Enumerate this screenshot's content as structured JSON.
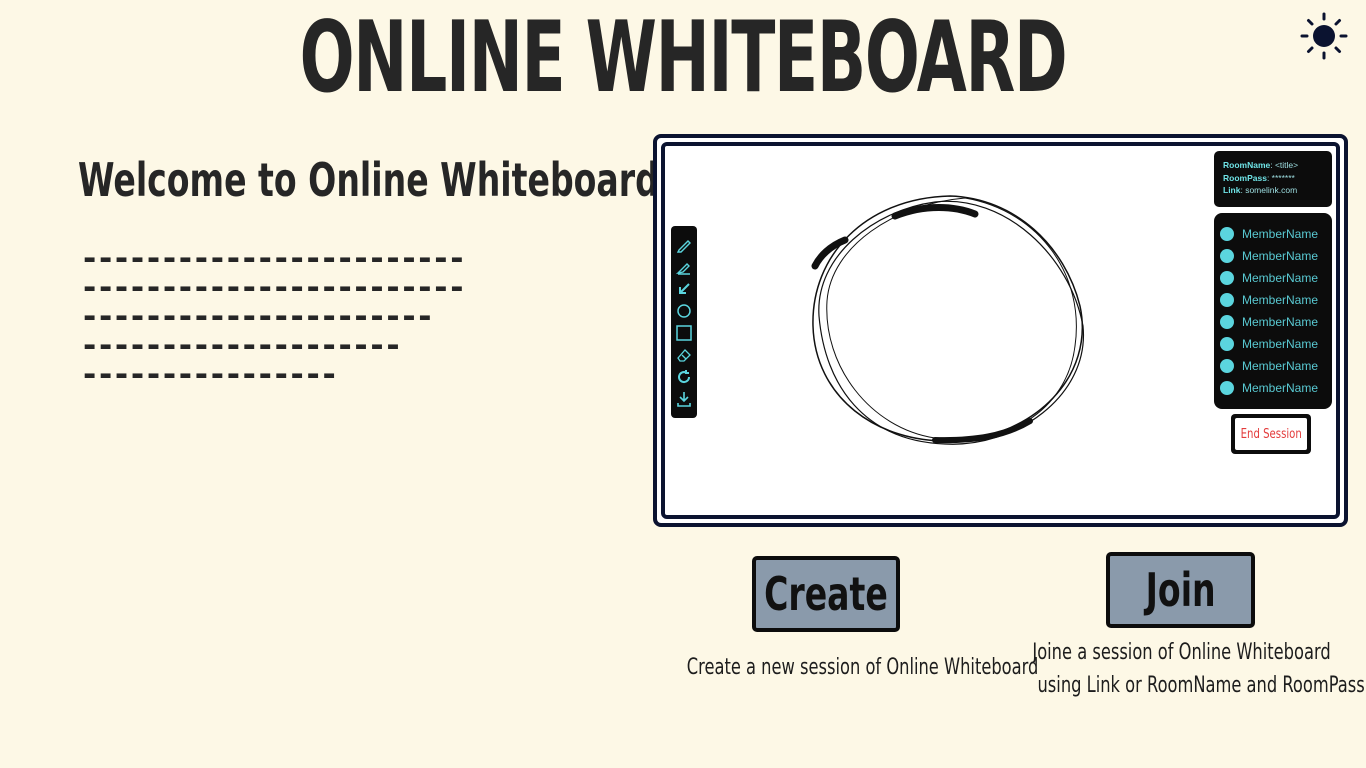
{
  "header": {
    "title": "ONLINE WHITEBOARD",
    "theme_icon": "sun-icon"
  },
  "welcome": {
    "heading": "Welcome to Online Whiteboard",
    "description_lines": [
      "------------------------",
      "------------------------",
      "----------------------",
      "--------------------",
      "----------------"
    ]
  },
  "preview": {
    "room_info": {
      "room_name_label": "RoomName",
      "room_name_value": ": <title>",
      "room_pass_label": "RoomPass",
      "room_pass_value": ": *******",
      "link_label": "Link",
      "link_value": ": somelink.com"
    },
    "members": [
      "MemberName",
      "MemberName",
      "MemberName",
      "MemberName",
      "MemberName",
      "MemberName",
      "MemberName",
      "MemberName"
    ],
    "end_session_label": "End Session",
    "toolbar_icons": [
      "pencil-icon",
      "highlighter-icon",
      "arrow-icon",
      "circle-icon",
      "square-icon",
      "eraser-icon",
      "refresh-icon",
      "download-icon"
    ],
    "member_color": "#5bd5de",
    "end_session_color": "#e33b3b"
  },
  "actions": {
    "create_label": "Create",
    "create_caption": "Create a new session of Online Whiteboard",
    "join_label": "Join",
    "join_caption_line1": "Joine a session of Online Whiteboard",
    "join_caption_line2": "using Link or RoomName and RoomPass",
    "button_color": "#8a9aab"
  },
  "colors": {
    "background": "#fdf8e6",
    "frame": "#0b1330",
    "text": "#262626"
  }
}
